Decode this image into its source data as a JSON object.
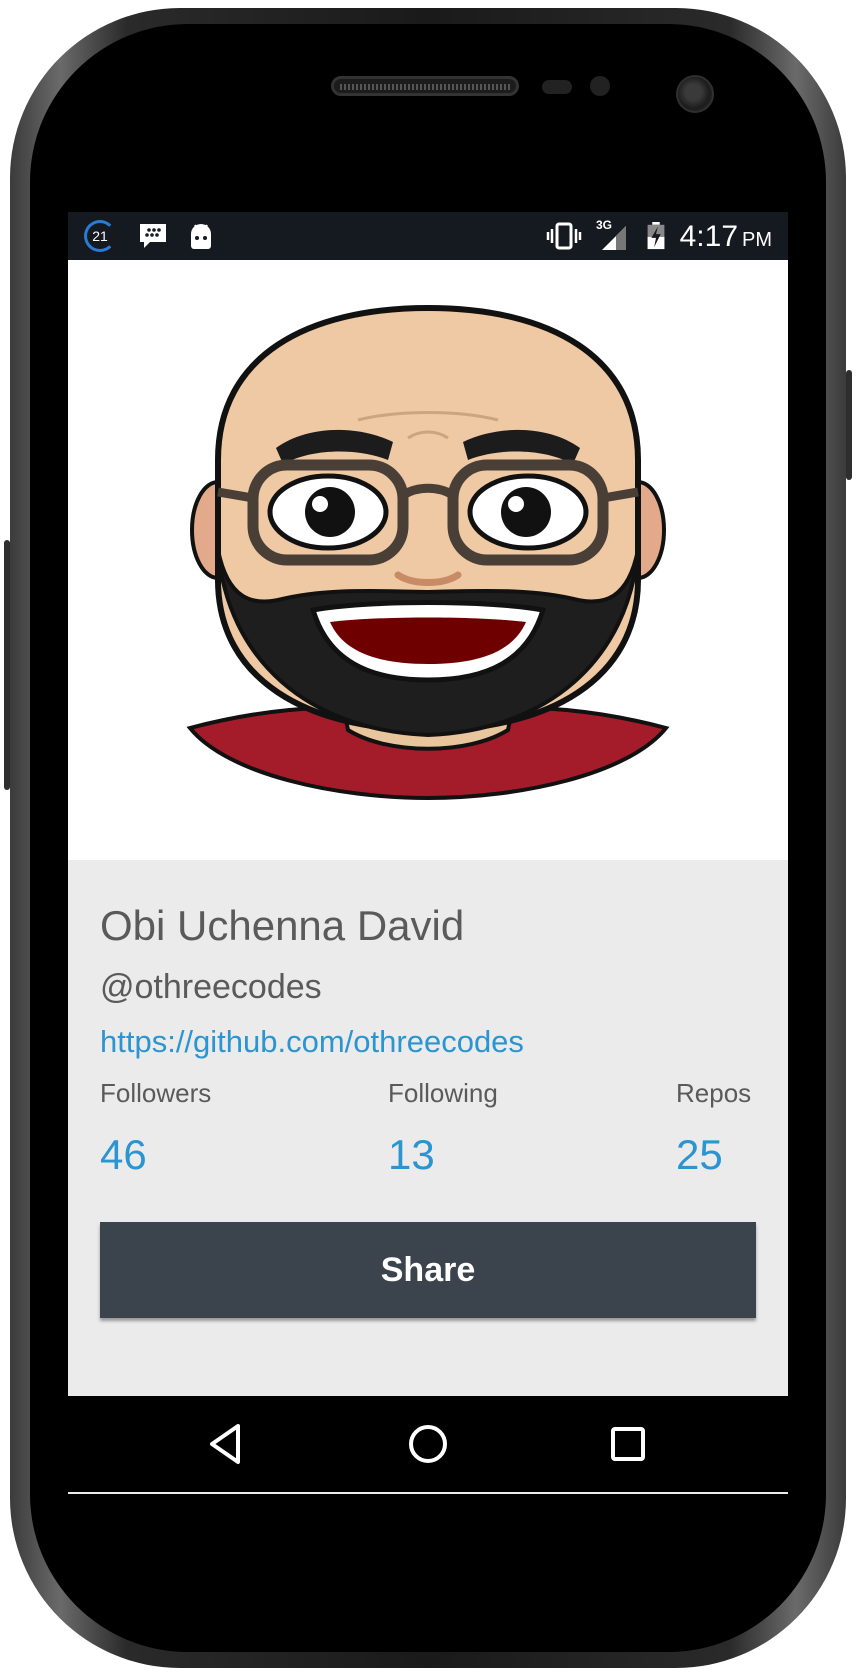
{
  "status_bar": {
    "notification_count": "21",
    "time": "4:17",
    "ampm": "PM",
    "network": "3G"
  },
  "profile": {
    "name": "Obi Uchenna David",
    "handle": "@othreecodes",
    "url": "https://github.com/othreecodes",
    "stats": [
      {
        "label": "Followers",
        "value": "46"
      },
      {
        "label": "Following",
        "value": "13"
      },
      {
        "label": "Repos",
        "value": "25"
      }
    ],
    "share_label": "Share"
  },
  "colors": {
    "accent": "#2a95d0",
    "button": "#3b444d",
    "status_bar": "#141a20",
    "panel": "#ebebeb"
  },
  "icons": {
    "status_left": [
      "notification-count-icon",
      "bbm-message-icon",
      "android-debug-icon"
    ],
    "status_right": [
      "vibrate-icon",
      "signal-3g-icon",
      "battery-charging-icon"
    ],
    "navigation": [
      "back-icon",
      "home-icon",
      "recents-icon"
    ]
  }
}
